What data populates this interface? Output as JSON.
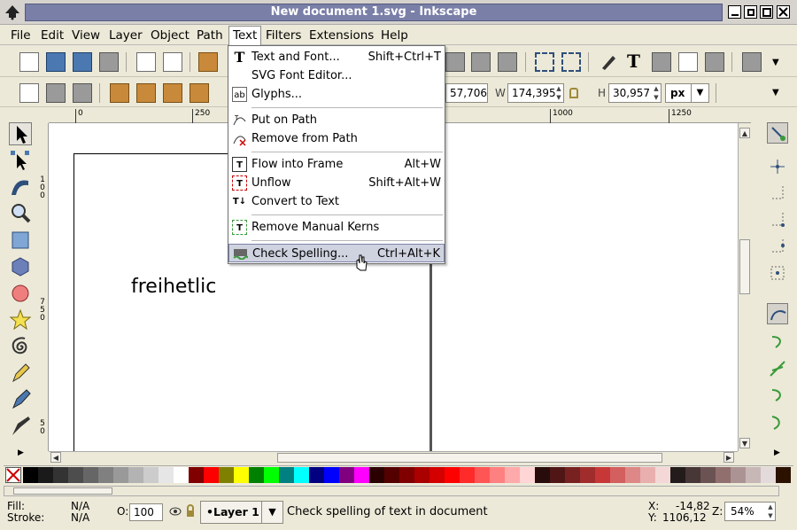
{
  "window": {
    "title": "New document 1.svg - Inkscape"
  },
  "menubar": {
    "items": [
      "File",
      "Edit",
      "View",
      "Layer",
      "Object",
      "Path",
      "Text",
      "Filters",
      "Extensions",
      "Help"
    ],
    "active": "Text"
  },
  "text_menu": {
    "items": [
      {
        "label": "Text and Font...",
        "accel": "Shift+Ctrl+T",
        "icon": "text-font-icon"
      },
      {
        "label": "SVG Font Editor...",
        "accel": "",
        "icon": ""
      },
      {
        "label": "Glyphs...",
        "accel": "",
        "icon": "glyphs-icon"
      },
      {
        "label": "Put on Path",
        "accel": "",
        "icon": "put-on-path-icon"
      },
      {
        "label": "Remove from Path",
        "accel": "",
        "icon": "remove-from-path-icon"
      },
      {
        "label": "Flow into Frame",
        "accel": "Alt+W",
        "icon": "flow-into-frame-icon"
      },
      {
        "label": "Unflow",
        "accel": "Shift+Alt+W",
        "icon": "unflow-icon"
      },
      {
        "label": "Convert to Text",
        "accel": "",
        "icon": "convert-to-text-icon"
      },
      {
        "label": "Remove Manual Kerns",
        "accel": "",
        "icon": "remove-kerns-icon"
      },
      {
        "label": "Check Spelling...",
        "accel": "Ctrl+Alt+K",
        "icon": "check-spelling-icon",
        "highlighted": true
      }
    ]
  },
  "controls": {
    "x_value": "57,706",
    "w_label": "W",
    "w_value": "174,395",
    "h_label": "H",
    "h_value": "30,957",
    "unit": "px"
  },
  "ruler": {
    "h_labels": [
      "0",
      "250",
      "1000",
      "1250"
    ],
    "v_labels": [
      "100",
      "750",
      "50"
    ]
  },
  "canvas": {
    "text": "freihetlic"
  },
  "palette": {
    "colors": [
      "#000000",
      "#1a1a1a",
      "#333333",
      "#4d4d4d",
      "#666666",
      "#808080",
      "#999999",
      "#b3b3b3",
      "#cccccc",
      "#e6e6e6",
      "#ffffff",
      "#800000",
      "#ff0000",
      "#808000",
      "#ffff00",
      "#008000",
      "#00ff00",
      "#008080",
      "#00ffff",
      "#000080",
      "#0000ff",
      "#800080",
      "#ff00ff",
      "#2b0000",
      "#550000",
      "#800000",
      "#aa0000",
      "#d40000",
      "#ff0000",
      "#ff2a2a",
      "#ff5555",
      "#ff8080",
      "#ffaaaa",
      "#ffd5d5",
      "#280b0b",
      "#501616",
      "#782121",
      "#a02c2c",
      "#c83737",
      "#d35f5f",
      "#de8787",
      "#e9afaf",
      "#f4d7d7",
      "#241c1c",
      "#483737",
      "#6c5353",
      "#916f6f",
      "#ac9393",
      "#c8b7b7",
      "#e3dbdb",
      "#2b1100"
    ]
  },
  "status": {
    "fill_label": "Fill:",
    "fill_value": "N/A",
    "stroke_label": "Stroke:",
    "stroke_value": "N/A",
    "opacity_label": "O:",
    "opacity_value": "100",
    "layer": "•Layer 1",
    "message": "Check spelling of text in document",
    "x_label": "X:",
    "x_value": "-14,82",
    "y_label": "Y:",
    "y_value": "1106,12",
    "zoom_label": "Z:",
    "zoom_value": "54%"
  }
}
